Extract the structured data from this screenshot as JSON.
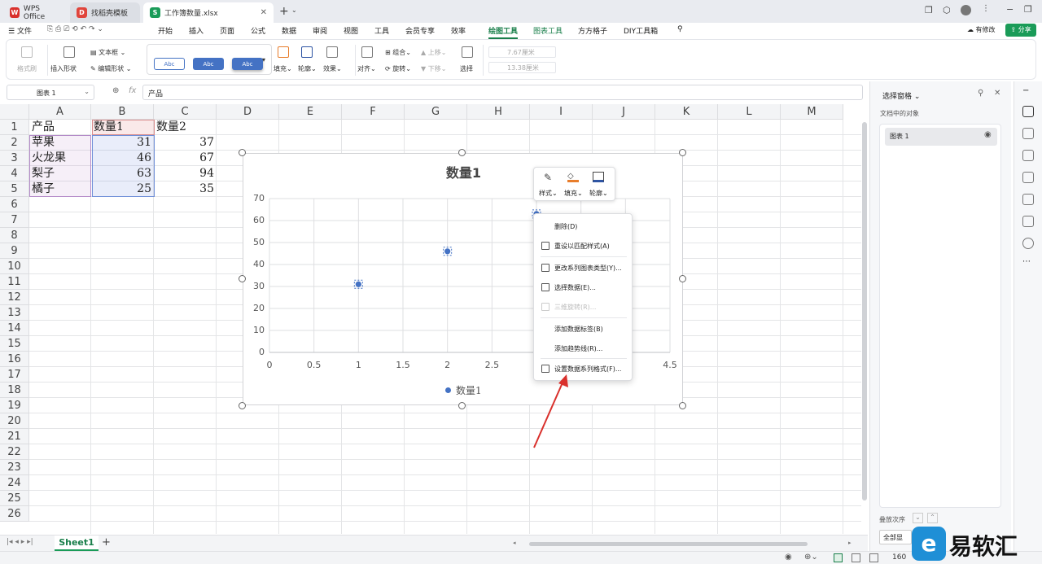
{
  "tabs": [
    {
      "label": "WPS Office",
      "icon": "W"
    },
    {
      "label": "找稻壳模板",
      "icon": "D"
    },
    {
      "label": "工作簿数量.xlsx",
      "icon": "S"
    }
  ],
  "menu": {
    "file": "文件",
    "items": [
      "开始",
      "插入",
      "页面",
      "公式",
      "数据",
      "审阅",
      "视图",
      "工具",
      "会员专享",
      "效率",
      "绘图工具",
      "图表工具",
      "方方格子",
      "DIY工具箱"
    ],
    "active": "绘图工具",
    "status_label": "有修改",
    "share_label": "分享"
  },
  "ribbon": {
    "format_painter": "格式刷",
    "insert_shape": "插入形状",
    "textbox": "文本框",
    "edit_shape": "编辑形状",
    "style_abc": "Abc",
    "fill": "填充",
    "outline": "轮廓",
    "effect": "效果",
    "align": "对齐",
    "group": "组合",
    "rotate": "旋转",
    "bring_up": "上移",
    "send_down": "下移",
    "select": "选择",
    "height": "7.67厘米",
    "width": "13.38厘米"
  },
  "formula": {
    "namebox": "图表 1",
    "content": "产品"
  },
  "columns": [
    "A",
    "B",
    "C",
    "D",
    "E",
    "F",
    "G",
    "H",
    "I",
    "J",
    "K",
    "L",
    "M"
  ],
  "rows": [
    "1",
    "2",
    "3",
    "4",
    "5",
    "6",
    "7",
    "8",
    "9",
    "10",
    "11",
    "12",
    "13",
    "14",
    "15",
    "16",
    "17",
    "18",
    "19",
    "20",
    "21",
    "22",
    "23",
    "24",
    "25",
    "26"
  ],
  "sheet": {
    "headers": [
      "产品",
      "数量1",
      "数量2"
    ],
    "rows": [
      [
        "苹果",
        "31",
        "37"
      ],
      [
        "火龙果",
        "46",
        "67"
      ],
      [
        "梨子",
        "63",
        "94"
      ],
      [
        "橘子",
        "25",
        "35"
      ]
    ]
  },
  "chart_data": {
    "type": "scatter",
    "title": "数量1",
    "x_ticks": [
      "0",
      "0.5",
      "1",
      "1.5",
      "2",
      "2.5",
      "3",
      "3.5",
      "4",
      "4.5"
    ],
    "y_ticks": [
      "0",
      "10",
      "20",
      "30",
      "40",
      "50",
      "60",
      "70"
    ],
    "xlim": [
      0,
      4.5
    ],
    "ylim": [
      0,
      70
    ],
    "series": [
      {
        "name": "数量1",
        "x": [
          1,
          2,
          3,
          4
        ],
        "y": [
          31,
          46,
          63,
          25
        ],
        "color": "#4472c4"
      }
    ],
    "legend": "bottom",
    "grid": true
  },
  "mini_toolbar": {
    "style": "样式",
    "fill": "填充",
    "outline": "轮廓"
  },
  "context_menu": [
    {
      "label": "删除(D)",
      "icon": false,
      "enabled": true
    },
    {
      "label": "重设以匹配样式(A)",
      "icon": true,
      "enabled": true
    },
    {
      "label": "更改系列图表类型(Y)...",
      "icon": true,
      "enabled": true
    },
    {
      "label": "选择数据(E)...",
      "icon": true,
      "enabled": true
    },
    {
      "label": "三维旋转(R)...",
      "icon": true,
      "enabled": false
    },
    {
      "label": "添加数据标签(B)",
      "icon": false,
      "enabled": true
    },
    {
      "label": "添加趋势线(R)...",
      "icon": false,
      "enabled": true
    },
    {
      "label": "设置数据系列格式(F)...",
      "icon": true,
      "enabled": true
    }
  ],
  "selection_pane": {
    "title": "选择窗格",
    "subtitle": "文档中的对象",
    "item": "图表 1",
    "order_label": "叠放次序",
    "show_all": "全部显"
  },
  "sheet_tab": {
    "name": "Sheet1"
  },
  "status": {
    "zoom": "160"
  },
  "watermark": "易软汇"
}
